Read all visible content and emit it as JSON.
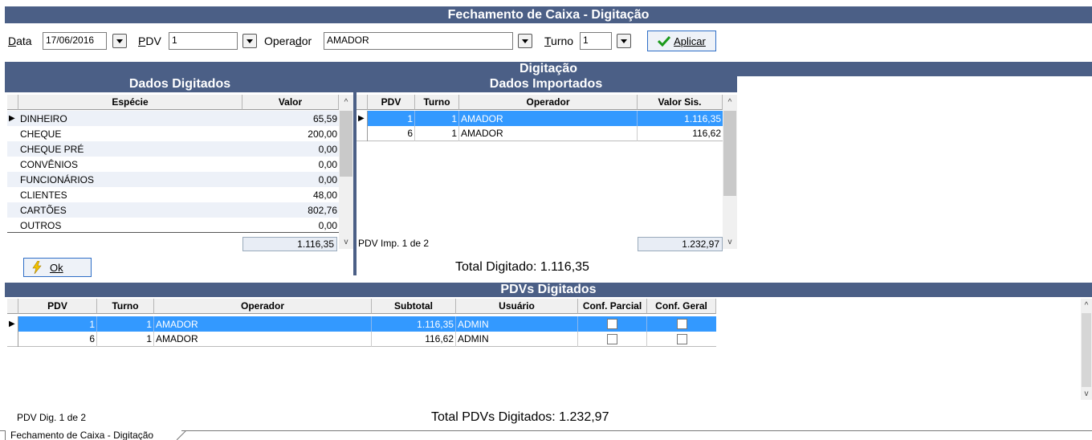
{
  "window_title": "Fechamento de Caixa - Digitação",
  "filters": {
    "data_label": "Data",
    "data_value": "17/06/2016",
    "pdv_label": "PDV",
    "pdv_value": "1",
    "operador_label": "Operador",
    "operador_value": "AMADOR",
    "turno_label": "Turno",
    "turno_value": "1",
    "aplicar_label": "Aplicar"
  },
  "digitacao_title": "Digitação",
  "dados_digitados": {
    "title": "Dados Digitados",
    "columns": [
      "Espécie",
      "Valor"
    ],
    "rows": [
      {
        "especie": "DINHEIRO",
        "valor": "65,59"
      },
      {
        "especie": "CHEQUE",
        "valor": "200,00"
      },
      {
        "especie": "CHEQUE PRÉ",
        "valor": "0,00"
      },
      {
        "especie": "CONVÊNIOS",
        "valor": "0,00"
      },
      {
        "especie": "FUNCIONÁRIOS",
        "valor": "0,00"
      },
      {
        "especie": "CLIENTES",
        "valor": "48,00"
      },
      {
        "especie": "CARTÕES",
        "valor": "802,76"
      },
      {
        "especie": "OUTROS",
        "valor": "0,00"
      }
    ],
    "total": "1.116,35",
    "ok_label": "Ok"
  },
  "dados_importados": {
    "title": "Dados Importados",
    "columns": [
      "PDV",
      "Turno",
      "Operador",
      "Valor Sis."
    ],
    "rows": [
      {
        "pdv": "1",
        "turno": "1",
        "operador": "AMADOR",
        "valor": "1.116,35"
      },
      {
        "pdv": "6",
        "turno": "1",
        "operador": "AMADOR",
        "valor": "116,62"
      }
    ],
    "footer_label": "PDV Imp. 1 de 2",
    "total": "1.232,97"
  },
  "total_digitado": "Total Digitado: 1.116,35",
  "pdvs_digitados": {
    "title": "PDVs Digitados",
    "columns": [
      "PDV",
      "Turno",
      "Operador",
      "Subtotal",
      "Usuário",
      "Conf. Parcial",
      "Conf. Geral"
    ],
    "rows": [
      {
        "pdv": "1",
        "turno": "1",
        "operador": "AMADOR",
        "subtotal": "1.116,35",
        "usuario": "ADMIN"
      },
      {
        "pdv": "6",
        "turno": "1",
        "operador": "AMADOR",
        "subtotal": "116,62",
        "usuario": "ADMIN"
      }
    ],
    "footer_label": "PDV Dig. 1 de 2",
    "total_label": "Total PDVs Digitados: 1.232,97"
  },
  "bottom_tab": "Fechamento de Caixa - Digitação",
  "colors": {
    "bar": "#4b5f86",
    "selection": "#3399ff"
  }
}
